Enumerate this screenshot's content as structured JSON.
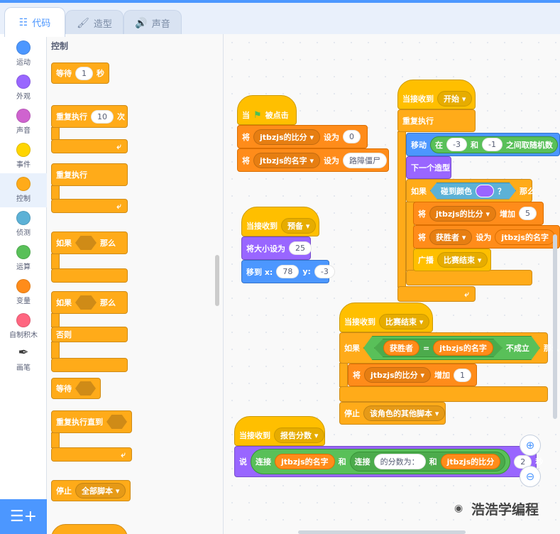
{
  "tabs": [
    {
      "label": "代码",
      "icon": "code-icon"
    },
    {
      "label": "造型",
      "icon": "brush-icon"
    },
    {
      "label": "声音",
      "icon": "speaker-icon"
    }
  ],
  "categories": [
    {
      "label": "运动",
      "color": "#4c97ff"
    },
    {
      "label": "外观",
      "color": "#9966ff"
    },
    {
      "label": "声音",
      "color": "#cf63cf"
    },
    {
      "label": "事件",
      "color": "#ffd500"
    },
    {
      "label": "控制",
      "color": "#ffab19"
    },
    {
      "label": "侦测",
      "color": "#5cb1d6"
    },
    {
      "label": "运算",
      "color": "#59c059"
    },
    {
      "label": "变量",
      "color": "#ff8c1a"
    },
    {
      "label": "自制积木",
      "color": "#ff6680"
    },
    {
      "label": "画笔",
      "color": "#0fbd8c"
    }
  ],
  "palette": {
    "title": "控制",
    "wait_label": "等待",
    "wait_value": "1",
    "wait_unit": "秒",
    "repeat_label": "重复执行",
    "repeat_value": "10",
    "repeat_unit": "次",
    "forever_label": "重复执行",
    "if_label": "如果",
    "then_label": "那么",
    "ifelse_if": "如果",
    "ifelse_then": "那么",
    "else_label": "否则",
    "waituntil_label": "等待",
    "repeatuntil_label": "重复执行直到",
    "stop_label": "停止",
    "stop_value": "全部脚本"
  },
  "scripts": {
    "flag_script": {
      "when": "当",
      "clicked": "被点击",
      "set1": "将",
      "set1_var": "jtbzjs的比分",
      "set1_to": "设为",
      "set1_value": "0",
      "set2": "将",
      "set2_var": "jtbzjs的名字",
      "set2_to": "设为",
      "set2_value": "路障僵尸"
    },
    "receive_ready": {
      "when": "当接收到",
      "msg": "预备",
      "size_label": "将大小设为",
      "size_value": "25",
      "goto_label": "移到 x:",
      "goto_x": "78",
      "y_label": "y:",
      "goto_y": "-3"
    },
    "receive_start": {
      "when": "当接收到",
      "msg": "开始",
      "forever": "重复执行",
      "move_label": "移动",
      "move_in": "在",
      "move_a": "-3",
      "move_and": "和",
      "move_b": "-1",
      "move_rand": "之间取随机数",
      "next_costume": "下一个造型",
      "if": "如果",
      "touch_color": "碰到颜色",
      "q": "？",
      "then": "那么",
      "touch_color_value": "#9966ff",
      "set_a": "将",
      "set_a_var": "jtbzjs的比分",
      "set_a_inc": "增加",
      "set_a_value": "5",
      "set_b": "将",
      "set_b_var": "获胜者",
      "set_b_to": "设为",
      "set_b_value": "jtbzjs的名字",
      "broadcast": "广播",
      "broadcast_msg": "比赛结束"
    },
    "receive_end": {
      "when": "当接收到",
      "msg": "比赛结束",
      "if": "如果",
      "winner": "获胜者",
      "eq": "=",
      "name": "jtbzjs的名字",
      "not_true": "不成立",
      "then": "那么",
      "set": "将",
      "set_var": "jtbzjs的比分",
      "inc": "增加",
      "value": "1",
      "stop": "停止",
      "stop_value": "该角色的其他脚本"
    },
    "receive_report": {
      "when": "当接收到",
      "msg": "报告分数",
      "say": "说",
      "join1": "连接",
      "join1_a": "jtbzjs的名字",
      "and1": "和",
      "join2": "连接",
      "join2_a": "的分数为：",
      "and2": "和",
      "join2_b": "jtbzjs的比分",
      "secs_value": "2",
      "secs": "秒"
    }
  },
  "watermark": "浩浩学编程"
}
